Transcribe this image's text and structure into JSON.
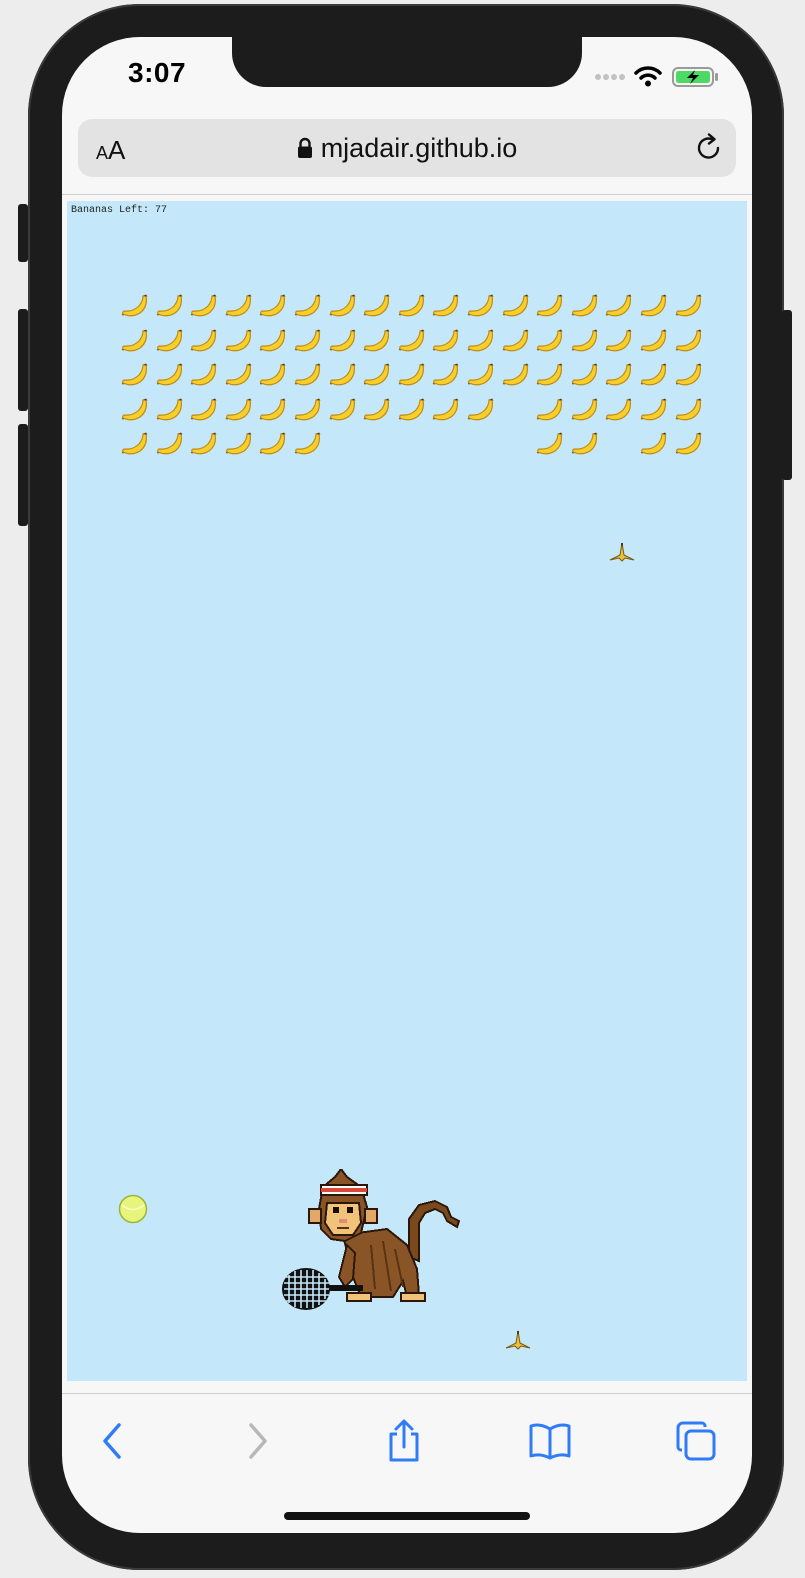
{
  "status_bar": {
    "time": "3:07",
    "icons": [
      "signal-dots-icon",
      "wifi-icon",
      "battery-charging-icon"
    ]
  },
  "browser": {
    "text_size_label_small": "A",
    "text_size_label_large": "A",
    "url": "mjadair.github.io",
    "icons": [
      "lock-icon",
      "reload-icon"
    ]
  },
  "game": {
    "score_label": "Bananas Left: 77",
    "background_color": "#c4e8fa",
    "banana_rows": [
      [
        1,
        1,
        1,
        1,
        1,
        1,
        1,
        1,
        1,
        1,
        1,
        1,
        1,
        1,
        1,
        1,
        1
      ],
      [
        1,
        1,
        1,
        1,
        1,
        1,
        1,
        1,
        1,
        1,
        1,
        1,
        1,
        1,
        1,
        1,
        1
      ],
      [
        1,
        1,
        1,
        1,
        1,
        1,
        1,
        1,
        1,
        1,
        1,
        1,
        1,
        1,
        1,
        1,
        1
      ],
      [
        1,
        1,
        1,
        1,
        1,
        1,
        1,
        1,
        1,
        1,
        1,
        0,
        1,
        1,
        1,
        1,
        1
      ],
      [
        1,
        1,
        1,
        1,
        1,
        1,
        0,
        0,
        0,
        0,
        0,
        0,
        1,
        1,
        0,
        1,
        1
      ]
    ],
    "sprites": [
      "banana-peel-icon",
      "tennis-ball-icon",
      "monkey-player-icon",
      "tennis-racket-icon"
    ]
  },
  "toolbar": {
    "icons": [
      "back-icon",
      "forward-icon",
      "share-icon",
      "bookmarks-icon",
      "tabs-icon"
    ],
    "accent_color": "#2f7cf6",
    "disabled_color": "#b8b8b8"
  }
}
